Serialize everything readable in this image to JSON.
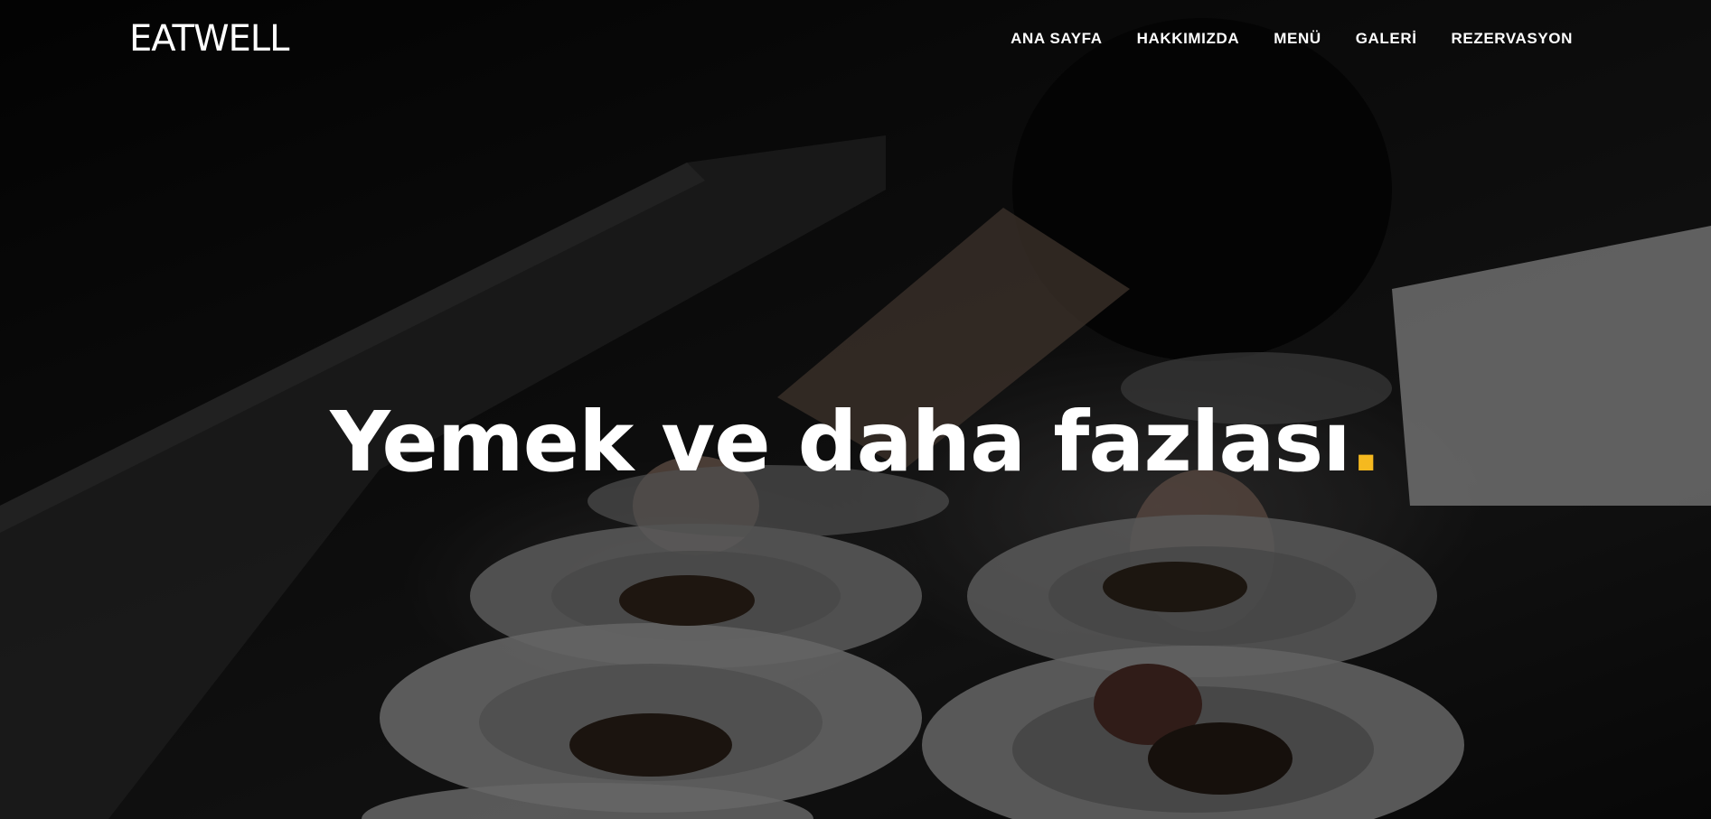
{
  "brand": {
    "logo_text": "EATWELL"
  },
  "nav": {
    "items": [
      {
        "label": "ANA SAYFA"
      },
      {
        "label": "HAKKIMIZDA"
      },
      {
        "label": "MENÜ"
      },
      {
        "label": "GALERİ"
      },
      {
        "label": "REZERVASYON"
      }
    ]
  },
  "hero": {
    "headline": "Yemek ve daha fazlası",
    "headline_dot": ".",
    "background_image": "chef plating dishes in a dark restaurant kitchen"
  },
  "colors": {
    "accent": "#f5b91f",
    "text": "#ffffff",
    "background": "#0a0a0a"
  }
}
